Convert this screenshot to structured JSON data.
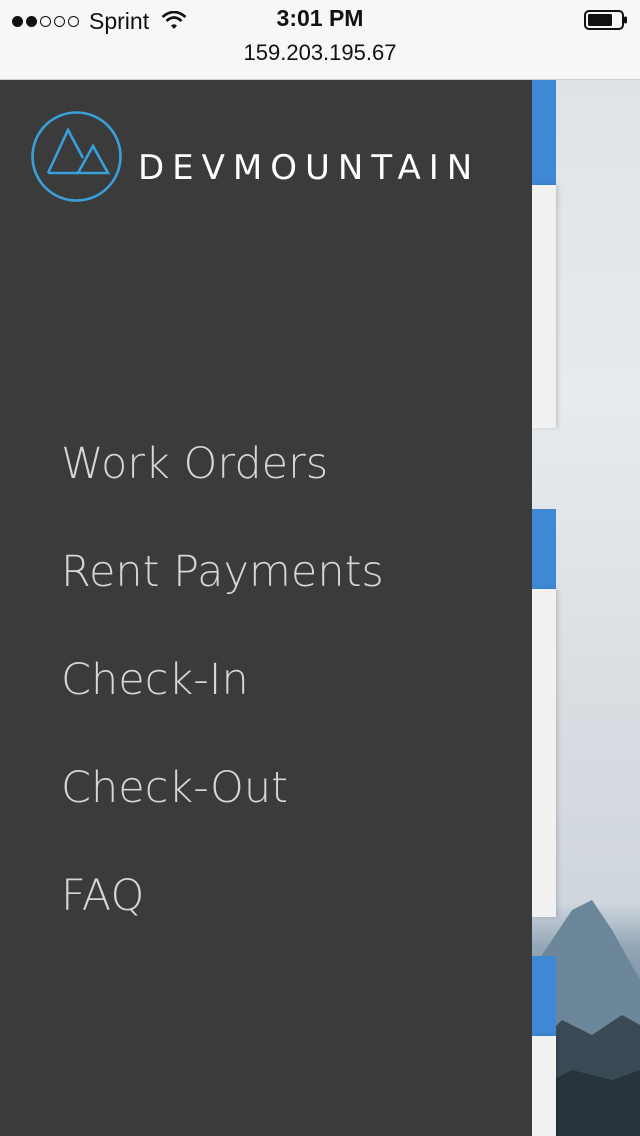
{
  "status_bar": {
    "carrier": "Sprint",
    "time": "3:01 PM",
    "url": "159.203.195.67",
    "signal_bars_filled": 2,
    "signal_bars_total": 5,
    "icons": [
      "signal-dots-icon",
      "wifi-icon",
      "battery-icon"
    ]
  },
  "drawer": {
    "logo_text": "DEVMOUNTAIN",
    "menu_items": [
      {
        "label": "Work Orders"
      },
      {
        "label": "Rent Payments"
      },
      {
        "label": "Check-In"
      },
      {
        "label": "Check-Out"
      },
      {
        "label": "FAQ"
      }
    ]
  },
  "colors": {
    "drawer_bg": "#3b3b3b",
    "menu_text": "#d6d6d6",
    "logo_accent": "#3aa0dc",
    "page_blue": "#3f88d6"
  }
}
